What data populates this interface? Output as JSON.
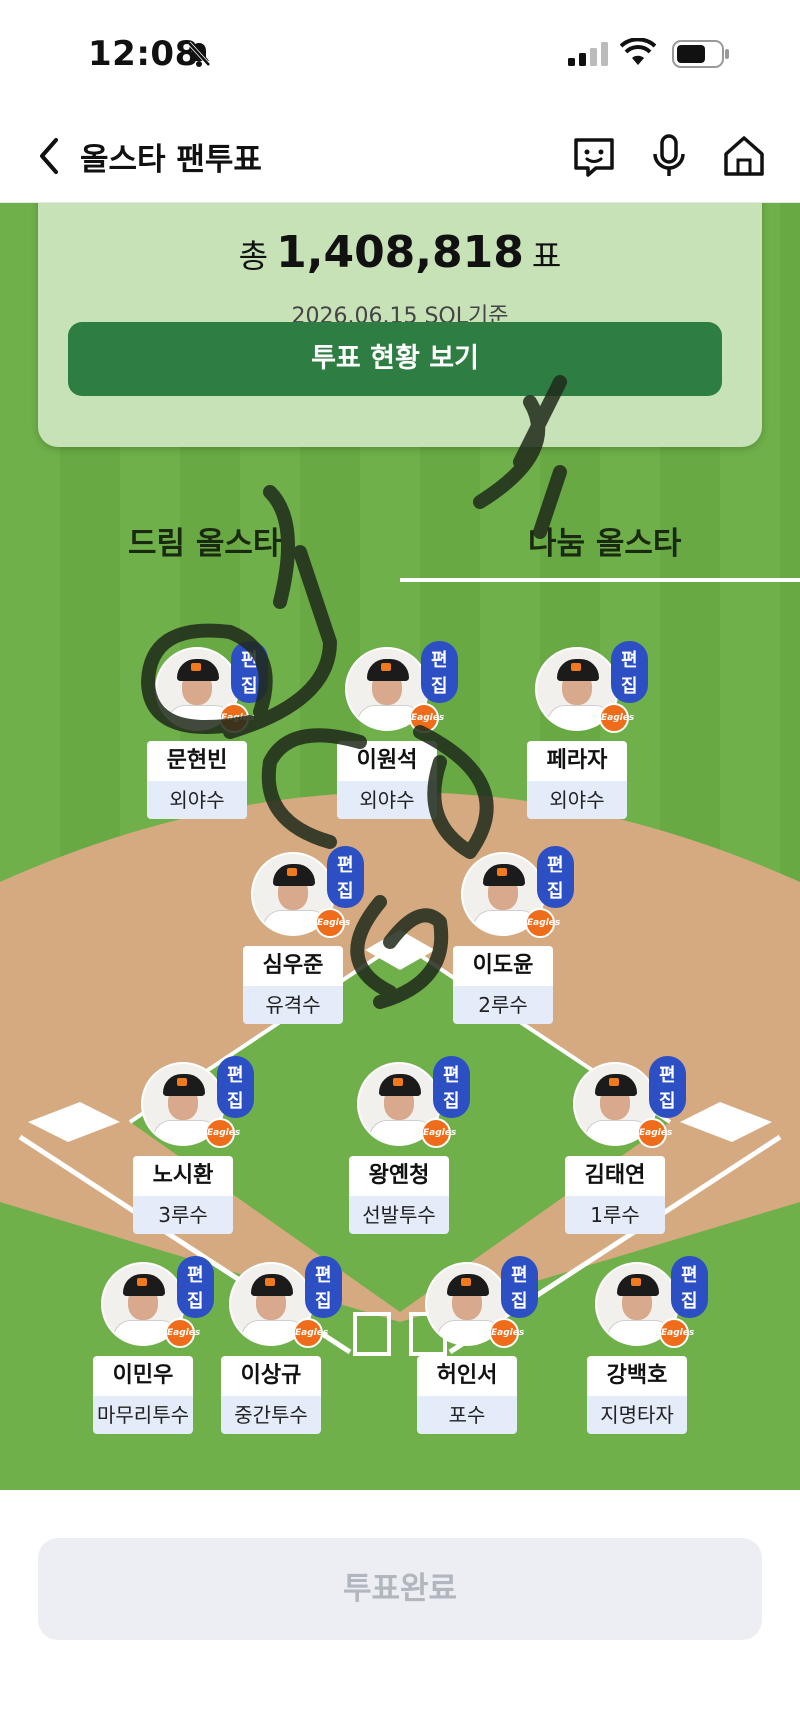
{
  "status": {
    "time": "12:08"
  },
  "header": {
    "title": "올스타 팬투표"
  },
  "vote": {
    "prefix": "총",
    "total": "1,408,818",
    "suffix": "표",
    "basis": "2026.06.15 SOL기준",
    "status_button": "투표 현황 보기"
  },
  "tabs": [
    {
      "label": "드림 올스타"
    },
    {
      "label": "나눔 올스타"
    }
  ],
  "edit_label": "편집",
  "players": [
    {
      "name": "문현빈",
      "position": "외야수"
    },
    {
      "name": "이원석",
      "position": "외야수"
    },
    {
      "name": "페라자",
      "position": "외야수"
    },
    {
      "name": "심우준",
      "position": "유격수"
    },
    {
      "name": "이도윤",
      "position": "2루수"
    },
    {
      "name": "노시환",
      "position": "3루수"
    },
    {
      "name": "왕옌청",
      "position": "선발투수"
    },
    {
      "name": "김태연",
      "position": "1루수"
    },
    {
      "name": "이민우",
      "position": "마무리투수"
    },
    {
      "name": "이상규",
      "position": "중간투수"
    },
    {
      "name": "허인서",
      "position": "포수"
    },
    {
      "name": "강백호",
      "position": "지명타자"
    }
  ],
  "team_logo_text": "Eagles",
  "bottom": {
    "done_button": "투표완료"
  },
  "colors": {
    "edit_badge": "#2d4fc4",
    "status_button": "#2e7d43",
    "field_grass": "#6fb04a",
    "infield_dirt": "#d6aa80"
  }
}
